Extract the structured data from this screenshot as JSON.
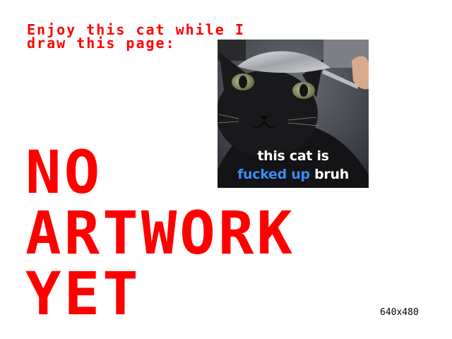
{
  "intro": {
    "line1": "Enjoy this cat while I",
    "line2": "draw this page:"
  },
  "meme": {
    "caption_line1": "this cat is",
    "caption_highlight": "fucked up",
    "caption_end": "bruh"
  },
  "placeholder": {
    "line1": "NO",
    "line2": "ARTWORK",
    "line3": "YET"
  },
  "dimensions_label": "640x480",
  "colors": {
    "accent": "#ff0000",
    "caption_blue": "#3d8df5",
    "background": "#ffffff"
  }
}
